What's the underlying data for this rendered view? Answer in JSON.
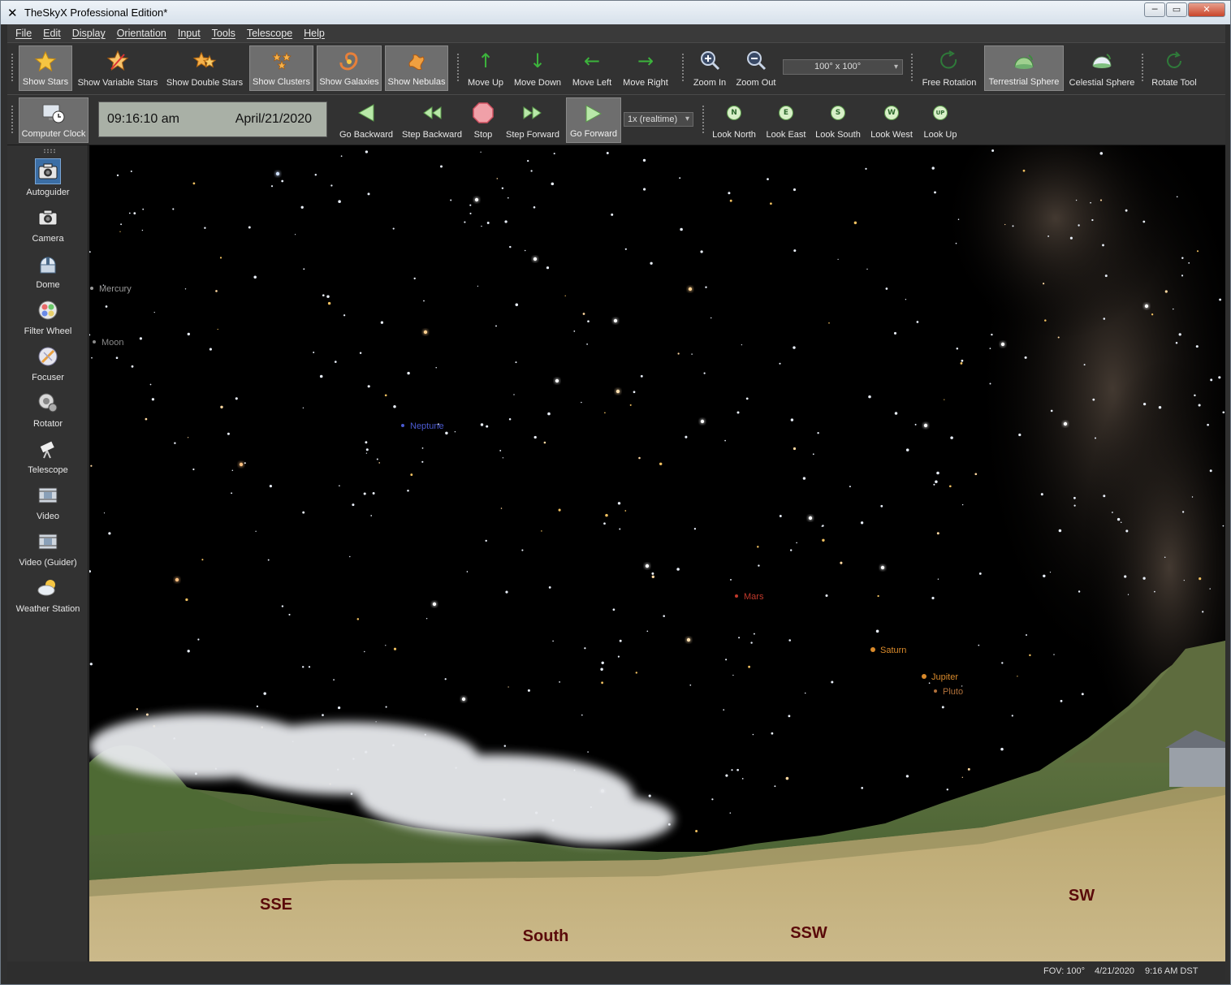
{
  "window": {
    "title": "TheSkyX Professional Edition*",
    "icon": "x-logo-icon",
    "controls": [
      "─",
      "▭",
      "✕"
    ]
  },
  "menu": [
    "File",
    "Edit",
    "Display",
    "Orientation",
    "Input",
    "Tools",
    "Telescope",
    "Help"
  ],
  "toolbar1": {
    "show_stars": "Show Stars",
    "show_variable_stars": "Show Variable Stars",
    "show_double_stars": "Show Double Stars",
    "show_clusters": "Show Clusters",
    "show_galaxies": "Show Galaxies",
    "show_nebulas": "Show Nebulas",
    "move_up": "Move Up",
    "move_down": "Move Down",
    "move_left": "Move Left",
    "move_right": "Move Right",
    "zoom_in": "Zoom In",
    "zoom_out": "Zoom Out",
    "fov_value": "100° x 100°",
    "free_rotation": "Free Rotation",
    "terrestrial_sphere": "Terrestrial Sphere",
    "celestial_sphere": "Celestial Sphere",
    "rotate_tool": "Rotate Tool"
  },
  "toolbar2": {
    "computer_clock": "Computer Clock",
    "time": "09:16:10 am",
    "date": "April/21/2020",
    "go_backward": "Go Backward",
    "step_backward": "Step Backward",
    "stop": "Stop",
    "step_forward": "Step Forward",
    "go_forward": "Go Forward",
    "rate": "1x (realtime)",
    "look_north": "Look North",
    "look_east": "Look East",
    "look_south": "Look South",
    "look_west": "Look West",
    "look_up": "Look Up",
    "look_north_badge": "N",
    "look_east_badge": "E",
    "look_south_badge": "S",
    "look_west_badge": "W",
    "look_up_badge": "UP"
  },
  "sidebar": [
    {
      "label": "Autoguider",
      "icon": "autoguider-camera-icon"
    },
    {
      "label": "Camera",
      "icon": "camera-icon"
    },
    {
      "label": "Dome",
      "icon": "dome-icon"
    },
    {
      "label": "Filter Wheel",
      "icon": "filter-wheel-icon"
    },
    {
      "label": "Focuser",
      "icon": "focuser-icon"
    },
    {
      "label": "Rotator",
      "icon": "rotator-icon"
    },
    {
      "label": "Telescope",
      "icon": "telescope-icon"
    },
    {
      "label": "Video",
      "icon": "video-icon"
    },
    {
      "label": "Video (Guider)",
      "icon": "video-guider-icon"
    },
    {
      "label": "Weather Station",
      "icon": "weather-station-icon"
    }
  ],
  "sky": {
    "objects": [
      {
        "name": "Mercury",
        "color": "#9a9a9a"
      },
      {
        "name": "Moon",
        "color": "#8a8a8a"
      },
      {
        "name": "Neptune",
        "color": "#4a5ad0"
      },
      {
        "name": "Mars",
        "color": "#c0392b"
      },
      {
        "name": "Saturn",
        "color": "#d98a2b"
      },
      {
        "name": "Jupiter",
        "color": "#d98a2b"
      },
      {
        "name": "Pluto",
        "color": "#b0703a"
      }
    ],
    "compass": [
      "SSE",
      "South",
      "SSW",
      "SW"
    ],
    "compass_color": "#5a0a0a"
  },
  "status": {
    "fov": "FOV: 100°",
    "date": "4/21/2020",
    "time": "9:16 AM DST"
  }
}
